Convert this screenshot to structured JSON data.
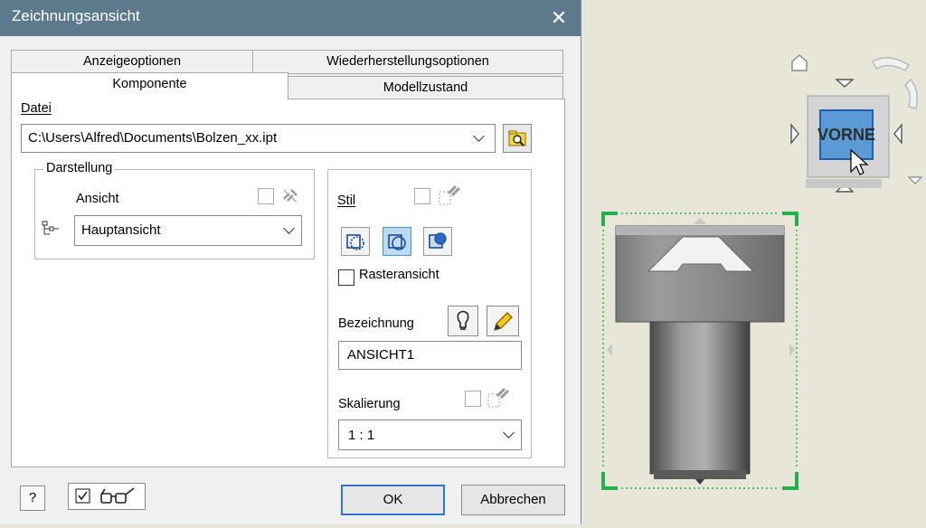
{
  "dialog": {
    "title": "Zeichnungsansicht",
    "close_label": "✕",
    "tabs": {
      "anzeigeoptionen": "Anzeigeoptionen",
      "wiederherstellungsoptionen": "Wiederherstellungsoptionen",
      "komponente": "Komponente",
      "modellzustand": "Modellzustand"
    },
    "datei": {
      "label": "Datei",
      "value": "C:\\Users\\Alfred\\Documents\\Bolzen_xx.ipt"
    },
    "darstellung": {
      "group_label": "Darstellung",
      "ansicht_label": "Ansicht",
      "ansicht_value": "Hauptansicht"
    },
    "stil": {
      "label": "Stil",
      "raster_label": "Rasteransicht",
      "raster_checked": false,
      "bezeichnung_label": "Bezeichnung",
      "bezeichnung_value": "ANSICHT1",
      "skalierung_label": "Skalierung",
      "skalierung_value": "1 : 1"
    },
    "buttons": {
      "help": "?",
      "ok": "OK",
      "cancel": "Abbrechen"
    }
  },
  "viewcube": {
    "face_label": "VORNE"
  },
  "colors": {
    "titlebar": "#5d7a8c",
    "selection_corner": "#22b14c",
    "viewcube_face": "#5b9bd5"
  }
}
